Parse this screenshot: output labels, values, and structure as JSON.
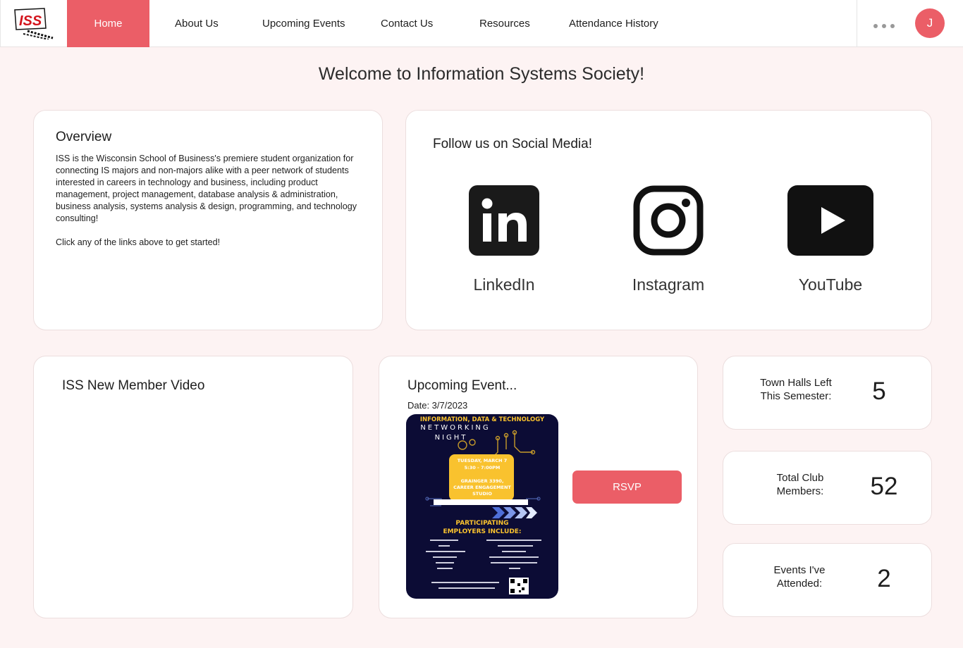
{
  "nav": {
    "logo_text": "ISS",
    "home": "Home",
    "about": "About Us",
    "events": "Upcoming Events",
    "contact": "Contact Us",
    "resources": "Resources",
    "attendance": "Attendance History",
    "more_icon": "more-dots-icon",
    "avatar_initial": "J"
  },
  "page": {
    "title": "Welcome to Information Systems Society!"
  },
  "overview": {
    "title": "Overview",
    "paragraph": "ISS is the Wisconsin School of Business's premiere student organization for connecting IS majors and non-majors alike with a peer network of students interested in careers in technology and business, including product management, project management, database analysis & administration, business analysis, systems analysis & design, programming, and technology consulting!",
    "prompt": "Click any of the links above to get started!"
  },
  "social": {
    "title": "Follow us on Social Media!",
    "items": [
      {
        "label": "LinkedIn",
        "icon": "linkedin-icon"
      },
      {
        "label": "Instagram",
        "icon": "instagram-icon"
      },
      {
        "label": "YouTube",
        "icon": "youtube-icon"
      }
    ]
  },
  "video": {
    "title": "ISS New Member Video"
  },
  "event": {
    "title": "Upcoming Event...",
    "date": "Date: 3/7/2023",
    "rsvp": "RSVP",
    "poster": {
      "header": "INFORMATION, DATA & TECHNOLOGY",
      "name_line1": "NETWORKING",
      "name_line2": "NIGHT",
      "when": "TUESDAY, MARCH 7",
      "time": "5:30 - 7:00PM",
      "where_line1": "GRAINGER 3390,",
      "where_line2": "CAREER ENGAGEMENT",
      "where_line3": "STUDIO",
      "participating_line1": "PARTICIPATING",
      "participating_line2": "EMPLOYERS INCLUDE:"
    }
  },
  "stats": {
    "town_halls": {
      "label_line1": "Town Halls Left",
      "label_line2": "This Semester:",
      "value": "5"
    },
    "members": {
      "label_line1": "Total Club",
      "label_line2": "Members:",
      "value": "52"
    },
    "attended": {
      "label_line1": "Events I've",
      "label_line2": "Attended:",
      "value": "2"
    }
  },
  "colors": {
    "accent": "#eb5e67",
    "background": "#fdf3f3"
  }
}
